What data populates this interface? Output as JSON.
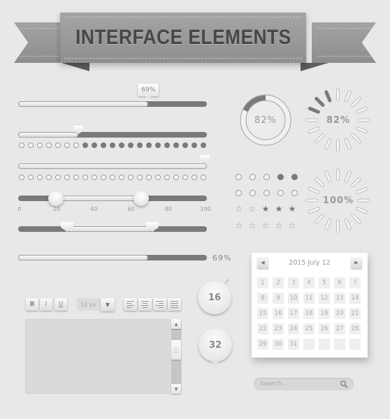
{
  "banner": {
    "title": "INTERFACE ELEMENTS"
  },
  "progress_tooltip": {
    "value": 69,
    "label": "69%"
  },
  "slider_pin": {
    "value": 32
  },
  "step_dots_filled": {
    "total": 21,
    "filled_from": 8
  },
  "slider_max": {
    "value": 100
  },
  "step_dots_empty": {
    "total": 21
  },
  "range_slider": {
    "min": 20,
    "max": 65,
    "ticks": [
      "0",
      "20",
      "40",
      "60",
      "80",
      "100"
    ]
  },
  "pin_range_slider": {
    "min": 26,
    "max": 71
  },
  "progress_labeled": {
    "value": 69,
    "label": "69%"
  },
  "donut": {
    "value": 82,
    "label": "82%"
  },
  "spinner_partial": {
    "segments": 16,
    "active": [
      13,
      14,
      15
    ],
    "label": "82%"
  },
  "spinner_full": {
    "segments": 16,
    "active": [],
    "label": "100%"
  },
  "radio_rows": [
    {
      "count": 5,
      "selected": [
        4,
        5
      ]
    },
    {
      "count": 5,
      "selected": []
    }
  ],
  "star_rows": [
    {
      "count": 5,
      "rating": 3,
      "filled_from_end": true
    },
    {
      "count": 5,
      "rating": 0
    }
  ],
  "toolbar": {
    "bold": "B",
    "italic": "I",
    "underline": "U",
    "font_size": "10 px",
    "dropdown_arrow": "▼",
    "align_left": "align-left",
    "align_center": "align-center",
    "align_right": "align-right",
    "align_justify": "align-justify"
  },
  "textarea": {
    "value": ""
  },
  "scrollbar": {
    "up": "▲",
    "down": "▼"
  },
  "bubbles": [
    {
      "label": "16"
    },
    {
      "label": "32"
    }
  ],
  "calendar": {
    "title": "2015 July 12",
    "prev": "◀",
    "next": "▶",
    "days": [
      "1",
      "2",
      "3",
      "4",
      "5",
      "6",
      "7",
      "8",
      "9",
      "10",
      "11",
      "12",
      "13",
      "14",
      "15",
      "16",
      "17",
      "18",
      "19",
      "20",
      "21",
      "22",
      "23",
      "24",
      "25",
      "26",
      "27",
      "28",
      "29",
      "30",
      "31",
      "",
      "",
      "",
      ""
    ]
  },
  "search": {
    "placeholder": "Search...",
    "value": ""
  },
  "colors": {
    "background": "#e8e8e8",
    "dark": "#7a7a7a",
    "ribbon": "#9a9a9a",
    "ribbon_text": "#474747"
  }
}
